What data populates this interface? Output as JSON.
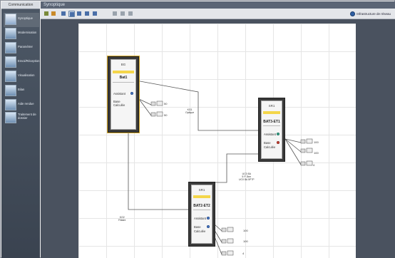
{
  "app": {
    "sidebar_title": "Communication",
    "header_title": "Synoptique"
  },
  "sidebar": {
    "items": [
      {
        "label": "Synoptique",
        "icon": "synoptic-icon",
        "active": true
      },
      {
        "label": "Modernisation",
        "icon": "modernization-icon"
      },
      {
        "label": "Paramétrer",
        "icon": "settings-icon"
      },
      {
        "label": "Envoi/Réception",
        "icon": "transfer-icon"
      },
      {
        "label": "Visualisation",
        "icon": "visualization-icon"
      },
      {
        "label": "Bilan",
        "icon": "report-icon"
      },
      {
        "label": "Aide rendue",
        "icon": "help-icon"
      },
      {
        "label": "Traitement de dossier",
        "icon": "folder-process-icon"
      }
    ]
  },
  "toolbar": {
    "buttons": [
      "save-icon",
      "open-icon",
      "link-icon",
      "view-a-icon",
      "view-b-icon",
      "view-c-icon",
      "view-d-icon",
      "zoom-icon",
      "grid-icon",
      "refresh-icon"
    ],
    "network_label": "Infrastructure de réseau"
  },
  "diagram": {
    "nodes": [
      {
        "id": "BG",
        "name": "Bat1",
        "assist_label": "Assistant",
        "base_label": "Base",
        "calc_label": "Calculée",
        "selected": true
      },
      {
        "id": "SR1",
        "name": "BAT3-ET1",
        "assist_label": "Assistant",
        "base_label": "Base",
        "calc_label": "Calculée"
      },
      {
        "id": "SR1",
        "name": "BAT2-ET2",
        "assist_label": "Assistant",
        "base_label": "Base",
        "calc_label": "Calculée"
      }
    ],
    "links": [
      {
        "label": "KG1\nOptique"
      },
      {
        "label": "KG2\nFiltaire"
      },
      {
        "label": "UC0 8A\n5 P 2km\nUC0 8A 5P7P"
      }
    ],
    "devices": [
      {
        "value": "50"
      },
      {
        "value": "50"
      },
      {
        "value": "100"
      },
      {
        "value": "100"
      },
      {
        "value": "4"
      },
      {
        "value": "100"
      },
      {
        "value": "100"
      },
      {
        "value": "4"
      }
    ]
  }
}
